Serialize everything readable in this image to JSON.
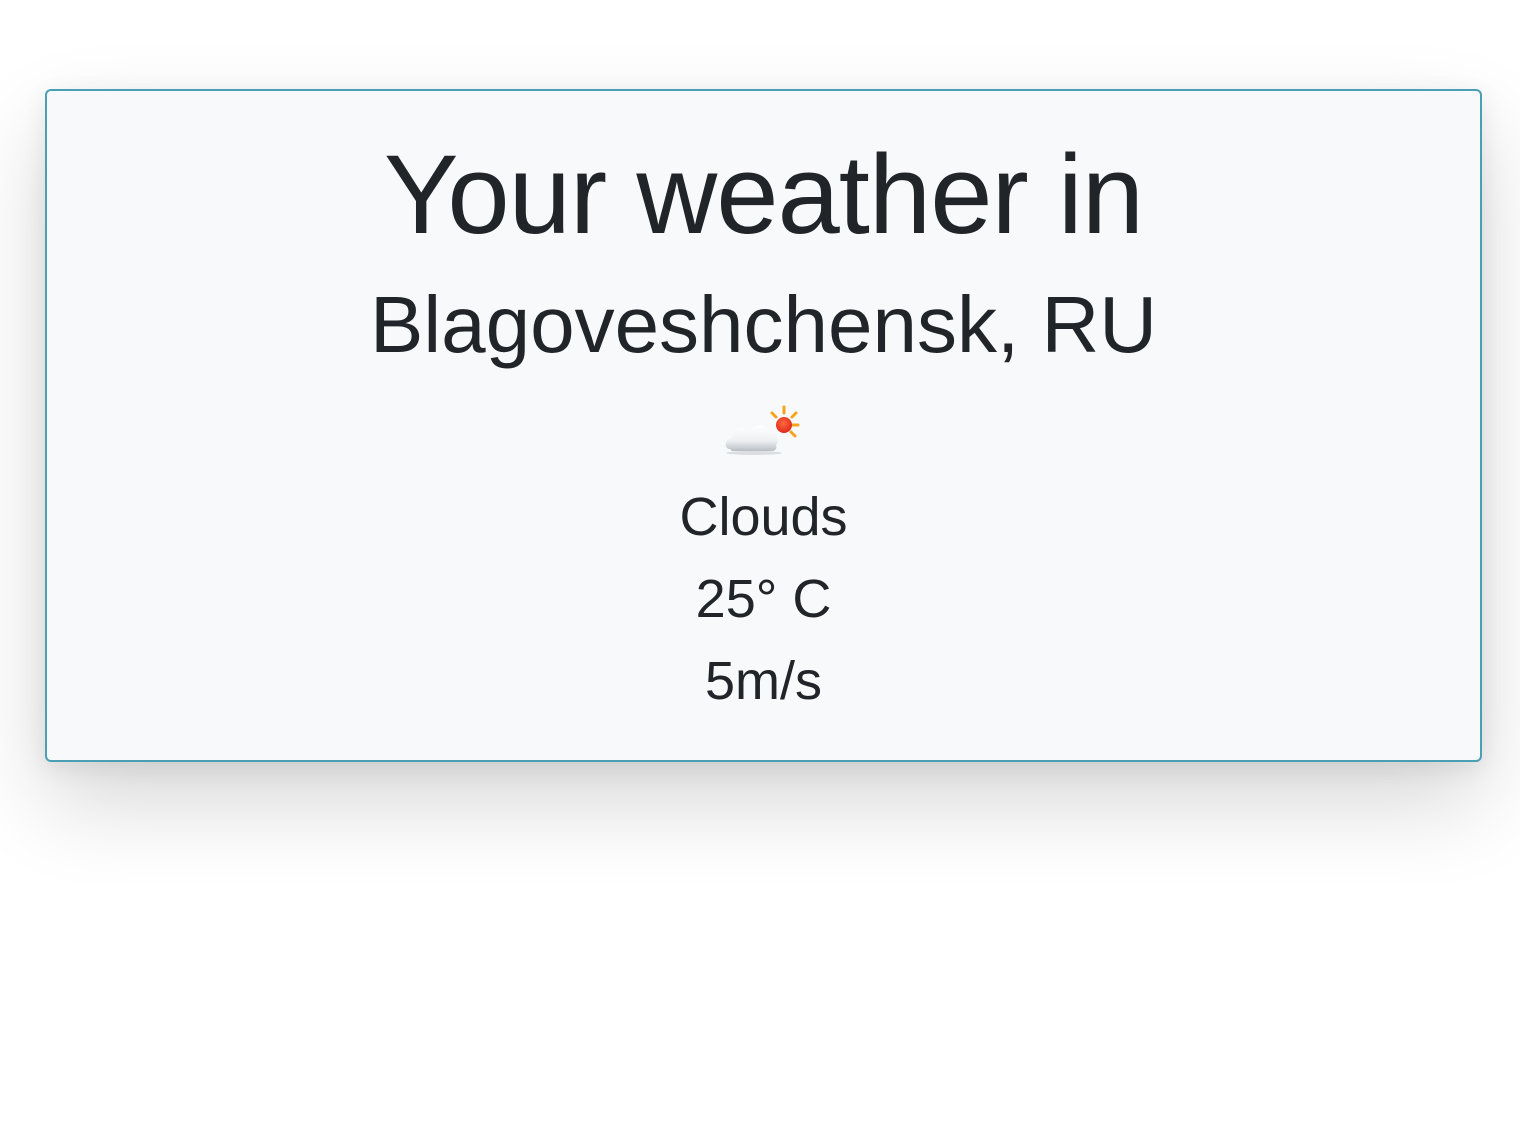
{
  "card": {
    "heading": "Your weather in",
    "location": "Blagoveshchensk, RU",
    "icon": "cloud-sun-icon",
    "condition": "Clouds",
    "temperature": "25° C",
    "wind_speed": "5m/s"
  },
  "colors": {
    "card_border": "#4a9fb5",
    "card_background": "#f8f9fa",
    "text": "#212529"
  }
}
